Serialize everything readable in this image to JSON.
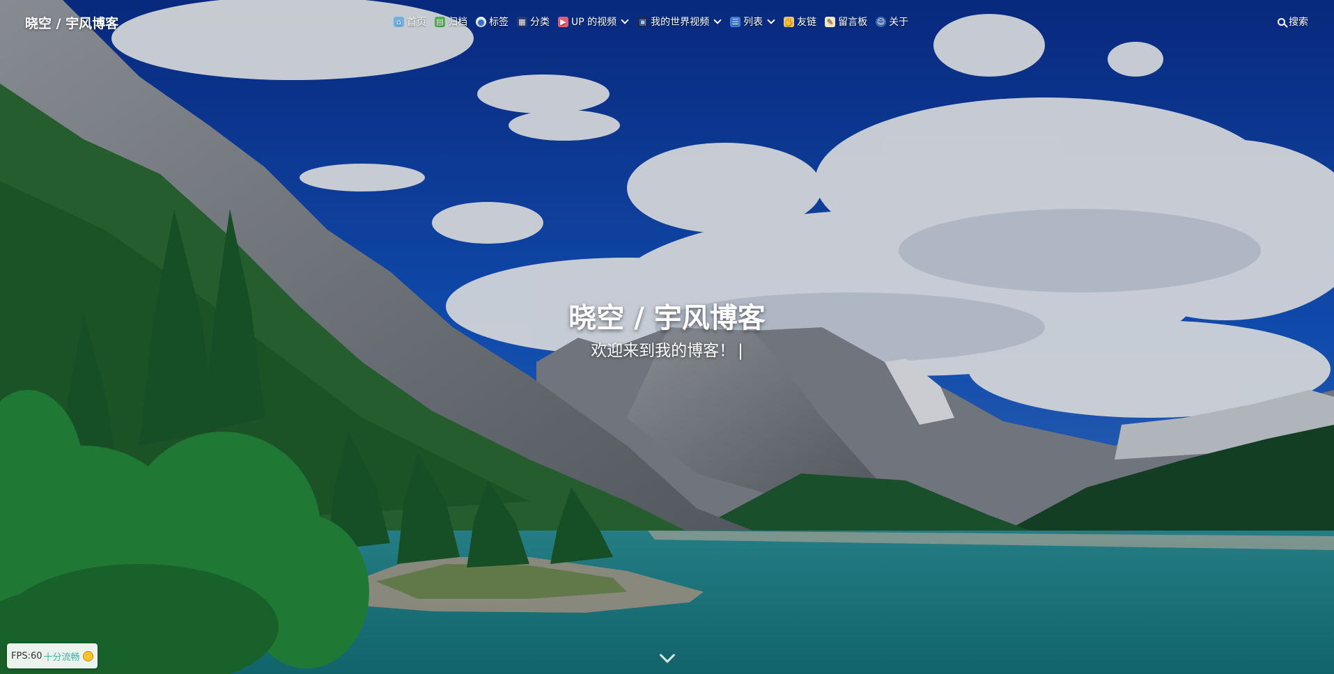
{
  "site": {
    "brand": "晓空 / 宇风博客"
  },
  "nav": {
    "items": [
      {
        "label": "首页",
        "icon": "home-icon",
        "dropdown": false
      },
      {
        "label": "归档",
        "icon": "archive-icon",
        "dropdown": false
      },
      {
        "label": "标签",
        "icon": "tag-icon",
        "dropdown": false
      },
      {
        "label": "分类",
        "icon": "category-icon",
        "dropdown": false
      },
      {
        "label": "UP 的视频",
        "icon": "video-icon",
        "dropdown": true
      },
      {
        "label": "我的世界视频",
        "icon": "minecraft-icon",
        "dropdown": true
      },
      {
        "label": "列表",
        "icon": "list-icon",
        "dropdown": true
      },
      {
        "label": "友链",
        "icon": "handshake-icon",
        "dropdown": false
      },
      {
        "label": "留言板",
        "icon": "message-icon",
        "dropdown": false
      },
      {
        "label": "关于",
        "icon": "about-icon",
        "dropdown": false
      }
    ],
    "search_label": "搜索"
  },
  "hero": {
    "title": "晓空 / 宇风博客",
    "subtitle": "欢迎来到我的博客！",
    "cursor": "|"
  },
  "fps": {
    "label": "FPS:60",
    "status": "十分流畅"
  },
  "colors": {
    "sky": "#0b3fa0",
    "lake": "#1e7f86",
    "forest": "#1f5e2c",
    "fps_status": "#36b5a3"
  }
}
